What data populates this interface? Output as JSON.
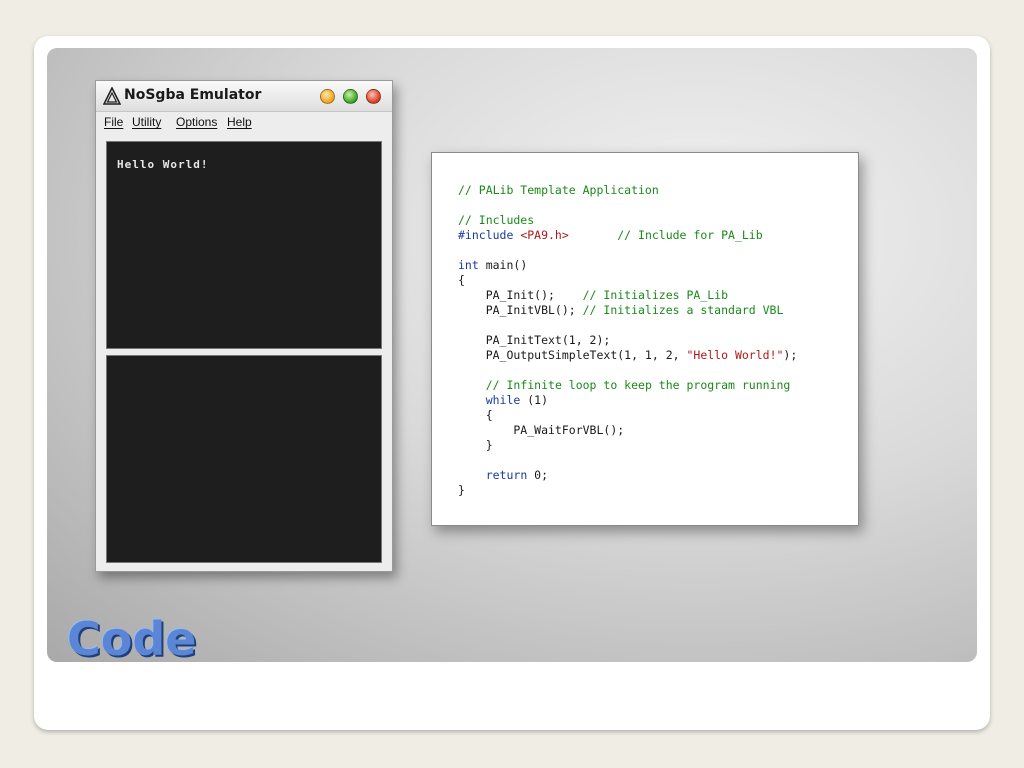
{
  "emulator": {
    "title": "NoSgba Emulator",
    "menu": [
      "File",
      "Utility",
      "Options",
      "Help"
    ],
    "top_screen_text": "Hello World!"
  },
  "code": {
    "lines": [
      [
        {
          "t": "// PALib Template Application",
          "c": "c"
        }
      ],
      [],
      [
        {
          "t": "// Includes",
          "c": "c"
        }
      ],
      [
        {
          "t": "#include ",
          "c": "p"
        },
        {
          "t": "<PA9.h>",
          "c": "s"
        },
        {
          "t": "       ",
          "c": ""
        },
        {
          "t": "// Include for PA_Lib",
          "c": "c"
        }
      ],
      [],
      [
        {
          "t": "int",
          "c": "k"
        },
        {
          "t": " main()",
          "c": ""
        }
      ],
      [
        {
          "t": "{",
          "c": ""
        }
      ],
      [
        {
          "t": "    PA_Init();    ",
          "c": ""
        },
        {
          "t": "// Initializes PA_Lib",
          "c": "c"
        }
      ],
      [
        {
          "t": "    PA_InitVBL(); ",
          "c": ""
        },
        {
          "t": "// Initializes a standard VBL",
          "c": "c"
        }
      ],
      [],
      [
        {
          "t": "    PA_InitText(1, 2);",
          "c": ""
        }
      ],
      [
        {
          "t": "    PA_OutputSimpleText(1, 1, 2, ",
          "c": ""
        },
        {
          "t": "\"Hello World!\"",
          "c": "s"
        },
        {
          "t": ");",
          "c": ""
        }
      ],
      [],
      [
        {
          "t": "    ",
          "c": ""
        },
        {
          "t": "// Infinite loop to keep the program running",
          "c": "c"
        }
      ],
      [
        {
          "t": "    ",
          "c": ""
        },
        {
          "t": "while",
          "c": "k"
        },
        {
          "t": " (1)",
          "c": ""
        }
      ],
      [
        {
          "t": "    {",
          "c": ""
        }
      ],
      [
        {
          "t": "        PA_WaitForVBL();",
          "c": ""
        }
      ],
      [
        {
          "t": "    }",
          "c": ""
        }
      ],
      [],
      [
        {
          "t": "    ",
          "c": ""
        },
        {
          "t": "return",
          "c": "k"
        },
        {
          "t": " 0;",
          "c": ""
        }
      ],
      [
        {
          "t": "}",
          "c": ""
        }
      ]
    ]
  },
  "slide": {
    "title": "Code"
  }
}
